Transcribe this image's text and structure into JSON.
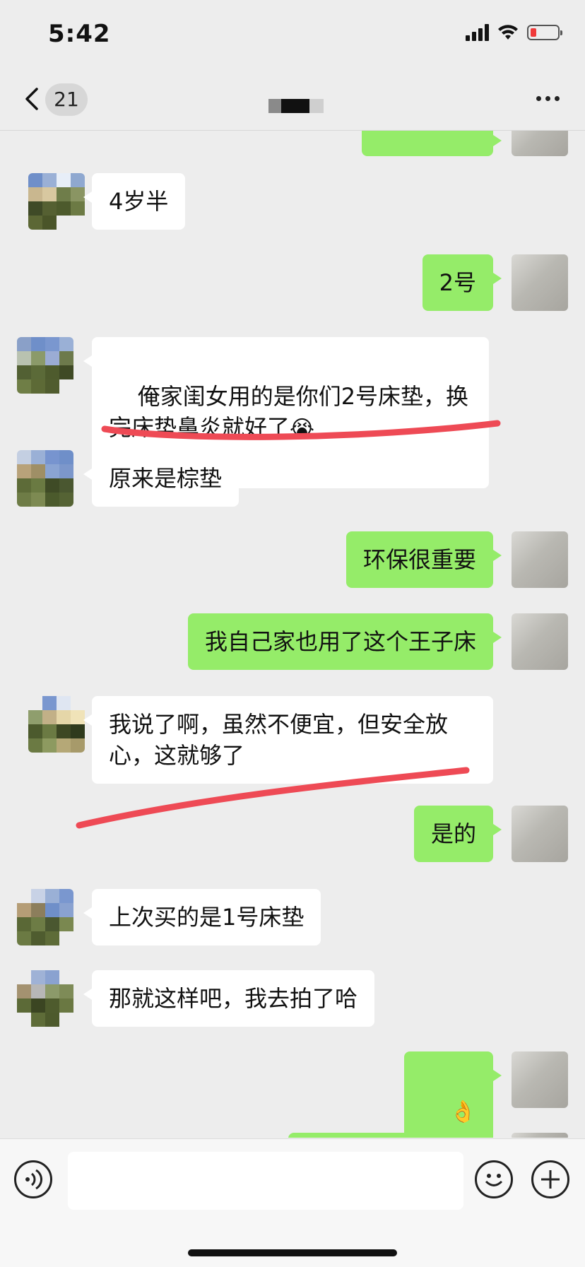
{
  "status_bar": {
    "time": "5:42"
  },
  "nav": {
    "unread_count": "21"
  },
  "messages": [
    {
      "side": "left",
      "text": "4岁半"
    },
    {
      "side": "right",
      "text": "2号"
    },
    {
      "side": "left",
      "text": "俺家闺女用的是你们2号床垫，换\n完床垫鼻炎就好了",
      "emoji": "😭"
    },
    {
      "side": "left",
      "text": "原来是棕垫"
    },
    {
      "side": "right",
      "text": "环保很重要"
    },
    {
      "side": "right",
      "text": "我自己家也用了这个王子床"
    },
    {
      "side": "left",
      "text": "我说了啊，虽然不便宜，但安全放\n心，这就够了"
    },
    {
      "side": "right",
      "text": "是的"
    },
    {
      "side": "left",
      "text": "上次买的是1号床垫"
    },
    {
      "side": "left",
      "text": "那就这样吧，我去拍了哈"
    },
    {
      "side": "right",
      "text": "👌"
    }
  ],
  "colors": {
    "bubble_me": "#95ec69",
    "bubble_other": "#ffffff",
    "annotation": "#ee4a55",
    "background": "#ededed"
  }
}
